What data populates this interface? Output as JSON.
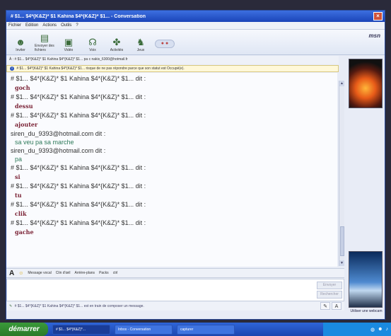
{
  "window": {
    "title": "# $1... $4*{K&Z}* $1 Kahina $4*{K&Z}* $1... - Conversation"
  },
  "menu": [
    "Fichier",
    "Edition",
    "Actions",
    "Outils",
    "?"
  ],
  "toolbar": [
    {
      "label": "Inviter",
      "icon": "invite-icon"
    },
    {
      "label": "Envoyer des fichiers",
      "icon": "send-files-icon"
    },
    {
      "label": "Vidéo",
      "icon": "video-icon"
    },
    {
      "label": "Voix",
      "icon": "voice-icon"
    },
    {
      "label": "Activités",
      "icon": "activities-icon"
    },
    {
      "label": "Jeux",
      "icon": "games-icon"
    }
  ],
  "brand": "msn",
  "to_line": "À : # $1... $4*{K&Z}* $1 Kahina $4*{K&Z}* $1... pa c nakis_6300@hotmail.fr",
  "info_line": "# $1... $4*{K&Z}* $1 Kahina $4*{K&Z}* $1... risque de ne pas répondre parce que son statut est Occupé(e).",
  "messages": [
    {
      "kind": "sender",
      "text": "# $1... $4*{K&Z}* $1 Kahina $4*{K&Z}* $1... dit :"
    },
    {
      "kind": "dark",
      "text": "goch"
    },
    {
      "kind": "sender",
      "text": "# $1... $4*{K&Z}* $1 Kahina $4*{K&Z}* $1... dit :"
    },
    {
      "kind": "dark",
      "text": "dessu"
    },
    {
      "kind": "sender",
      "text": "# $1... $4*{K&Z}* $1 Kahina $4*{K&Z}* $1... dit :"
    },
    {
      "kind": "dark",
      "text": "ajouter"
    },
    {
      "kind": "sender",
      "text": "siren_du_9393@hotmail.com dit :"
    },
    {
      "kind": "green",
      "text": "sa veu pa sa marche"
    },
    {
      "kind": "sender",
      "text": "siren_du_9393@hotmail.com dit :"
    },
    {
      "kind": "green",
      "text": "pa"
    },
    {
      "kind": "sender",
      "text": "# $1... $4*{K&Z}* $1 Kahina $4*{K&Z}* $1... dit :"
    },
    {
      "kind": "dark",
      "text": "si"
    },
    {
      "kind": "sender",
      "text": "# $1... $4*{K&Z}* $1 Kahina $4*{K&Z}* $1... dit :"
    },
    {
      "kind": "dark",
      "text": "tu"
    },
    {
      "kind": "sender",
      "text": "# $1... $4*{K&Z}* $1 Kahina $4*{K&Z}* $1... dit :"
    },
    {
      "kind": "dark",
      "text": "clik"
    },
    {
      "kind": "sender",
      "text": "# $1... $4*{K&Z}* $1 Kahina $4*{K&Z}* $1... dit :"
    },
    {
      "kind": "dark",
      "text": "gache"
    }
  ],
  "format_bar": {
    "font_label": "A",
    "emoticon_label": "☺",
    "items": [
      "Message vocal",
      "Clin d'œil",
      "Arrière-plans",
      "Packs",
      "ctrl"
    ]
  },
  "send": {
    "send_label": "Envoyer",
    "search_label": "Rechercher"
  },
  "status": "# $1... $4*{K&Z}* $1 Kahina $4*{K&Z}* $1... est en train de composer un message.",
  "format_right": [
    "✎",
    "A"
  ],
  "avatar_link": "Utiliser une webcam",
  "taskbar": {
    "start": "démarrer",
    "items": [
      {
        "label": "# $1... $4*{K&Z}*...",
        "active": true
      },
      {
        "label": "Inbox - Conversation",
        "active": false
      },
      {
        "label": "capturer",
        "active": false
      }
    ]
  },
  "colors": {
    "title_blue": "#1b44b8",
    "dark_message": "#7a2235",
    "green_message": "#2e7a5a",
    "start_green": "#2a7a28"
  }
}
